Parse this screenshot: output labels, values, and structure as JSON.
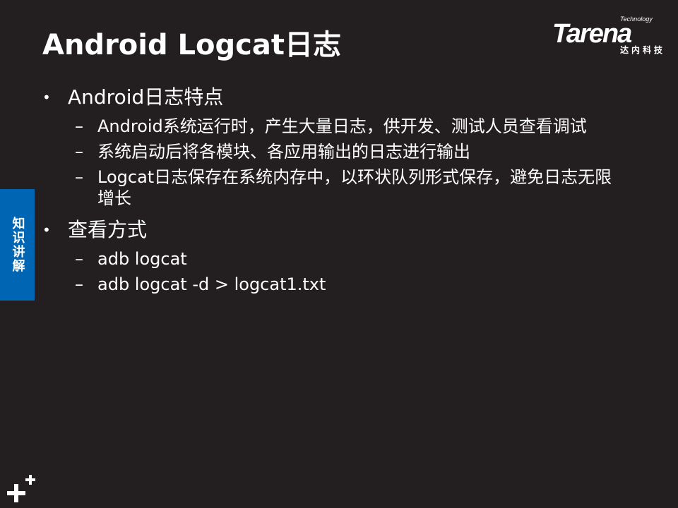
{
  "title": "Android Logcat日志",
  "logo": {
    "small": "Technology",
    "main": "Tarena",
    "sub": "达内科技"
  },
  "side_tab": "知识讲解",
  "sections": [
    {
      "heading": "Android日志特点",
      "items": [
        "Android系统运行时，产生大量日志，供开发、测试人员查看调试",
        "系统启动后将各模块、各应用输出的日志进行输出",
        "Logcat日志保存在系统内存中，以环状队列形式保存，避免日志无限增长"
      ]
    },
    {
      "heading": "查看方式",
      "items": [
        "adb logcat",
        "adb logcat -d > logcat1.txt"
      ]
    }
  ],
  "bullet_symbol": "•",
  "dash_symbol": "–",
  "colors": {
    "background": "#231f20",
    "text": "#ffffff",
    "side_tab": "#0066b3"
  },
  "icons": {
    "plus_mark": "plus-plus-icon"
  }
}
